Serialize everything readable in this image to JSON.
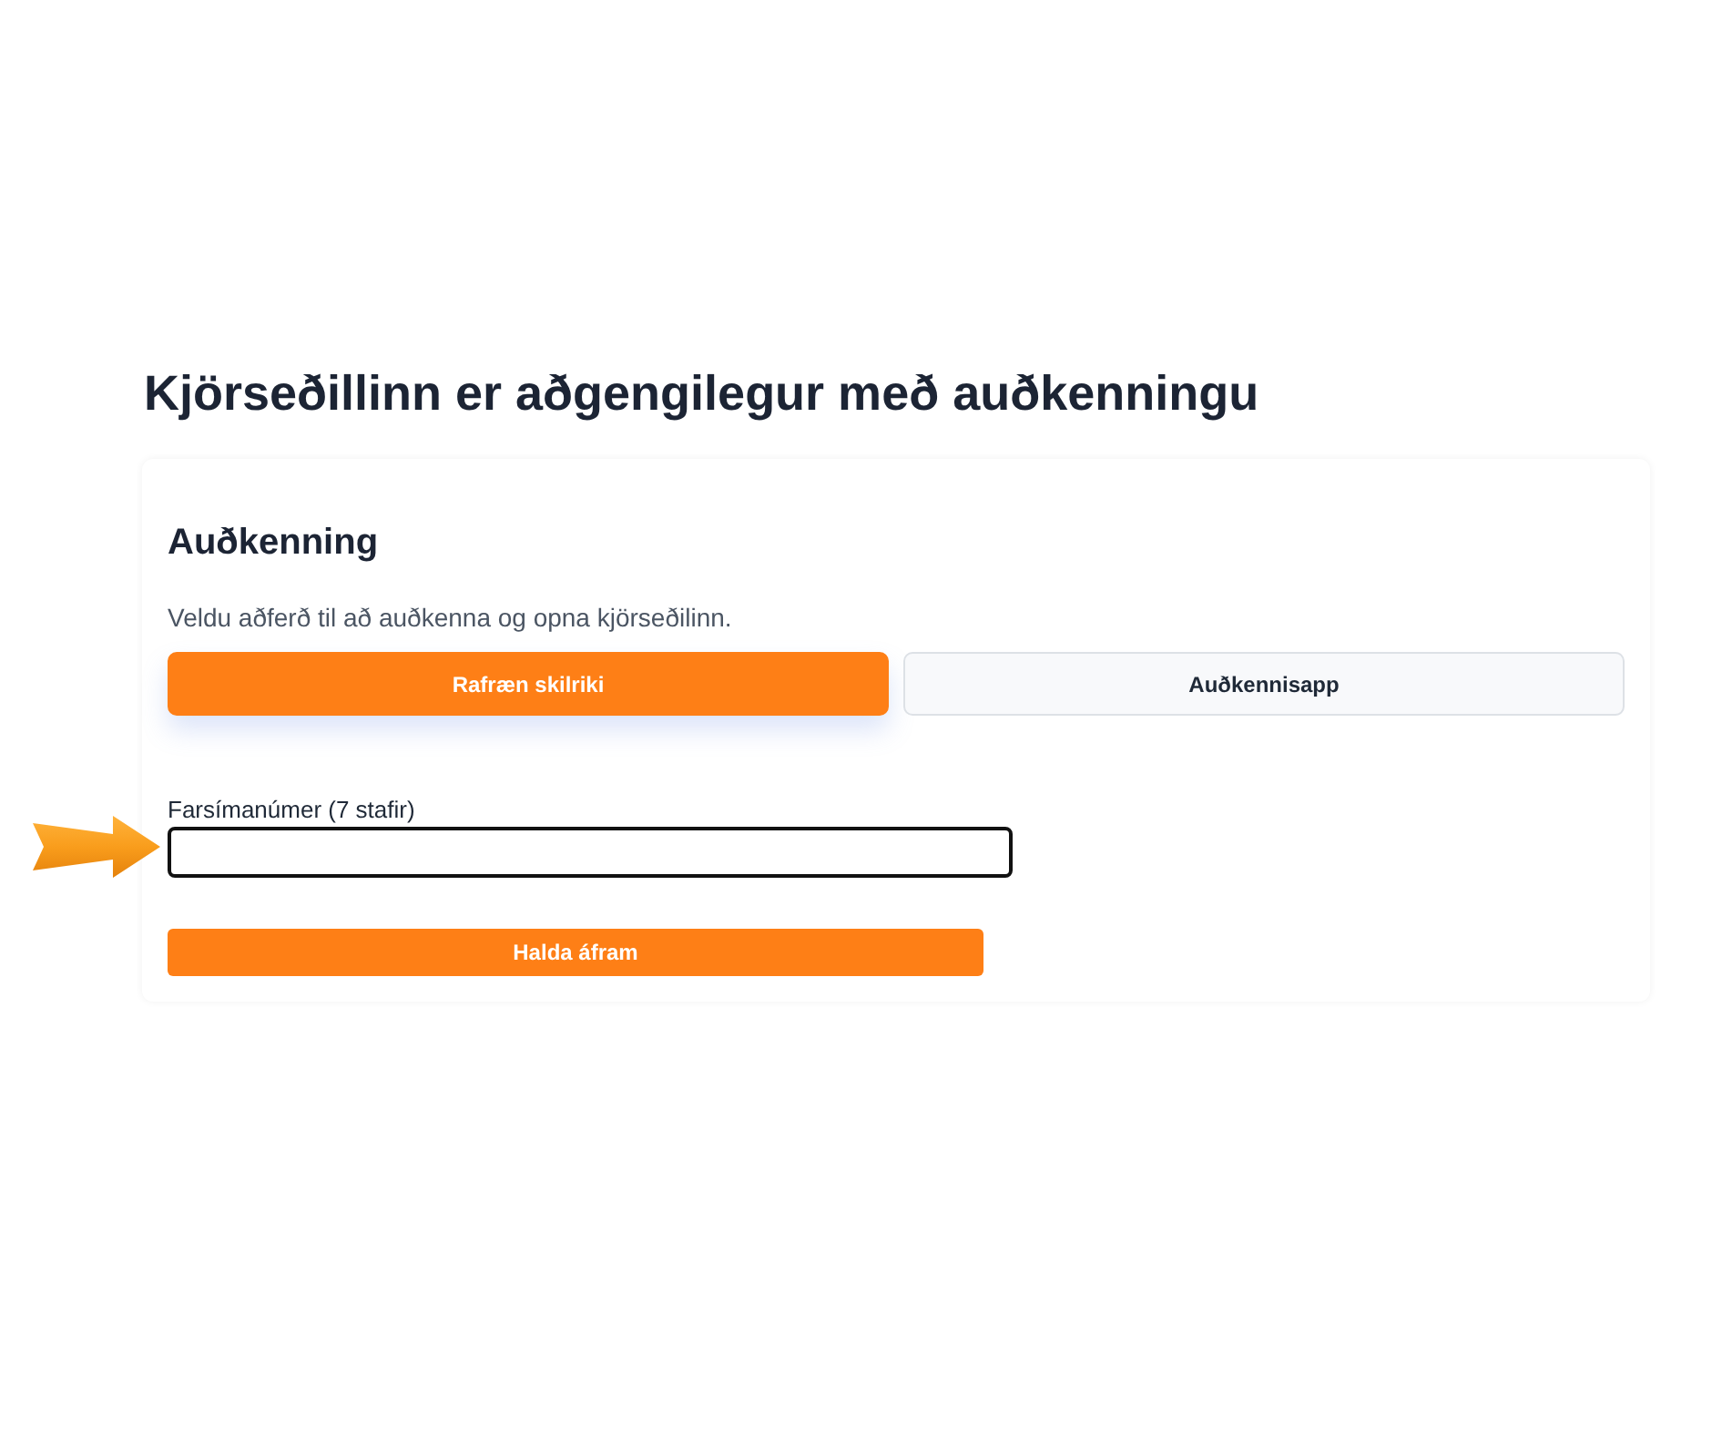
{
  "heading": "Kjörseðillinn er aðgengilegur með auðkenningu",
  "card": {
    "title": "Auðkenning",
    "description": "Veldu aðferð til að auðkenna og opna kjörseðilinn.",
    "tabs": [
      {
        "label": "Rafræn skilriki",
        "selected": true
      },
      {
        "label": "Auðkennisapp",
        "selected": false
      }
    ],
    "phone_field": {
      "label": "Farsímanúmer (7 stafir)"
    },
    "continue_button": "Halda áfram"
  }
}
